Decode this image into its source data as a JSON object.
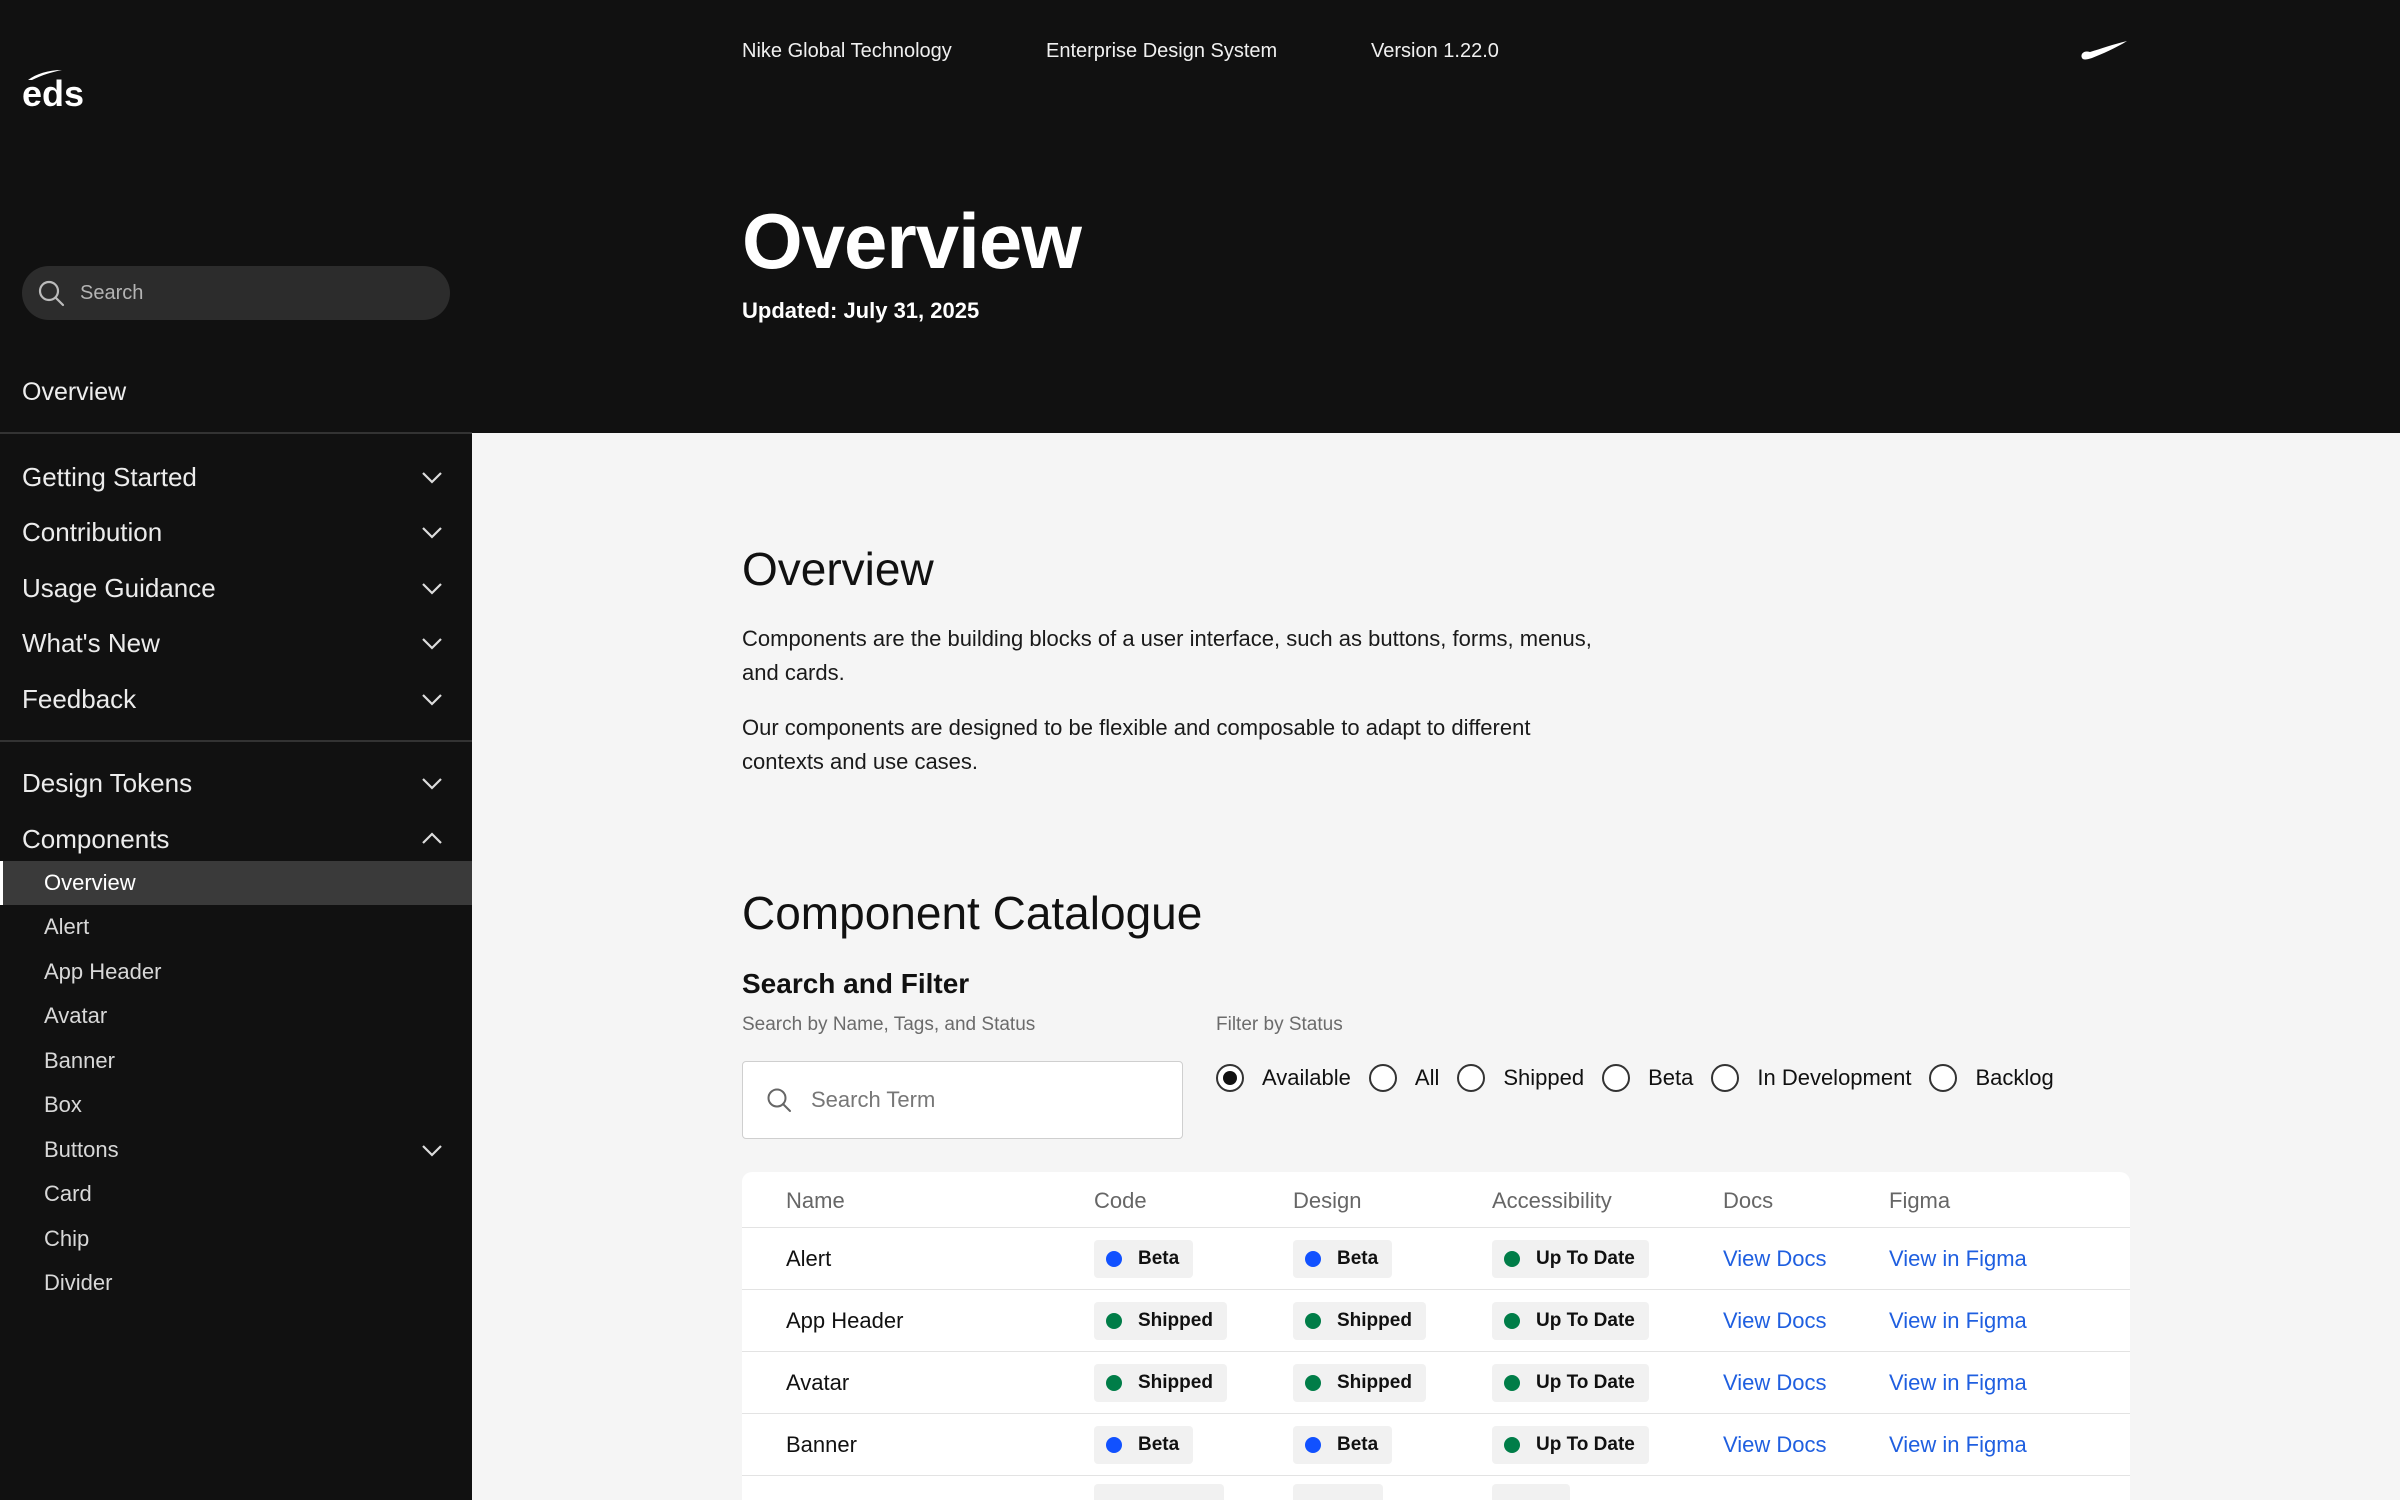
{
  "header": {
    "links": [
      "Nike Global Technology",
      "Enterprise Design System",
      "Version 1.22.0"
    ],
    "title": "Overview",
    "updated": "Updated: July 31, 2025"
  },
  "sidebar": {
    "logo_text": "eds",
    "search_placeholder": "Search",
    "overview": "Overview",
    "groups": [
      {
        "label": "Getting Started",
        "expanded": false
      },
      {
        "label": "Contribution",
        "expanded": false
      },
      {
        "label": "Usage Guidance",
        "expanded": false
      },
      {
        "label": "What's New",
        "expanded": false
      },
      {
        "label": "Feedback",
        "expanded": false
      },
      {
        "label": "Design Tokens",
        "expanded": false
      },
      {
        "label": "Components",
        "expanded": true
      }
    ],
    "component_items": [
      "Overview",
      "Alert",
      "App Header",
      "Avatar",
      "Banner",
      "Box",
      "Buttons",
      "Card",
      "Chip",
      "Divider"
    ],
    "active_item": "Overview"
  },
  "main": {
    "section_title": "Overview",
    "paragraphs": [
      "Components are the building blocks of a user interface, such as buttons, forms, menus, and cards.",
      "Our components are designed to be flexible and composable to adapt to different contexts and use cases."
    ],
    "catalogue_title": "Component Catalogue",
    "filter_title": "Search and Filter",
    "search_label": "Search by Name, Tags, and Status",
    "search_placeholder": "Search Term",
    "filter_label": "Filter by Status",
    "radios": [
      "Available",
      "All",
      "Shipped",
      "Beta",
      "In Development",
      "Backlog"
    ],
    "selected_radio": "Available"
  },
  "table": {
    "headers": [
      "Name",
      "Code",
      "Design",
      "Accessibility",
      "Docs",
      "Figma"
    ],
    "rows": [
      {
        "name": "Alert",
        "code": "Beta",
        "design": "Beta",
        "accessibility": "Up To Date",
        "docs": "View Docs",
        "figma": "View in Figma"
      },
      {
        "name": "App Header",
        "code": "Shipped",
        "design": "Shipped",
        "accessibility": "Up To Date",
        "docs": "View Docs",
        "figma": "View in Figma"
      },
      {
        "name": "Avatar",
        "code": "Shipped",
        "design": "Shipped",
        "accessibility": "Up To Date",
        "docs": "View Docs",
        "figma": "View in Figma"
      },
      {
        "name": "Banner",
        "code": "Beta",
        "design": "Beta",
        "accessibility": "Up To Date",
        "docs": "View Docs",
        "figma": "View in Figma"
      }
    ]
  },
  "colors": {
    "beta": "#1151ff",
    "shipped": "#007d48",
    "up_to_date": "#007d48",
    "link": "#1f5fe0",
    "dark_bg": "#111111"
  }
}
